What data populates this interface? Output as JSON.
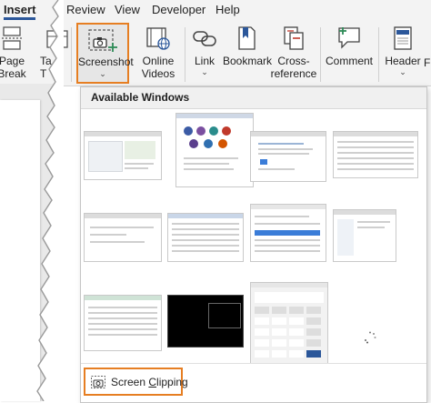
{
  "menu": {
    "tabs": [
      {
        "label": "Insert",
        "active": true
      },
      {
        "label": "Review",
        "active": false
      },
      {
        "label": "View",
        "active": false
      },
      {
        "label": "Developer",
        "active": false
      },
      {
        "label": "Help",
        "active": false
      }
    ]
  },
  "ribbon": {
    "page_break": {
      "line1": "Page",
      "line2": "Break"
    },
    "table": {
      "line1": "Ta",
      "line2": "T"
    },
    "screenshot": {
      "label": "Screenshot",
      "chevron": "⌄"
    },
    "online_videos": {
      "line1": "Online",
      "line2": "Videos"
    },
    "link": {
      "label": "Link",
      "chevron": "⌄"
    },
    "bookmark": {
      "label": "Bookmark"
    },
    "cross_reference": {
      "line1": "Cross-",
      "line2": "reference"
    },
    "comment": {
      "label": "Comment"
    },
    "header": {
      "label": "Header",
      "chevron": "⌄"
    },
    "footer": {
      "label": "F"
    }
  },
  "dropdown": {
    "title": "Available Windows",
    "windows_count": 12,
    "screen_clipping": {
      "prefix": "Screen ",
      "underlined": "C",
      "suffix": "lipping"
    }
  },
  "colors": {
    "accent_orange": "#e67e22",
    "word_blue": "#2b579a",
    "calc_dark": "#1e1e1e",
    "black_window": "#000000"
  },
  "icons": [
    "page-break-icon",
    "screenshot-icon",
    "online-videos-icon",
    "link-icon",
    "bookmark-icon",
    "cross-reference-icon",
    "comment-icon",
    "header-icon",
    "screen-clipping-icon",
    "loading-spinner-icon"
  ]
}
